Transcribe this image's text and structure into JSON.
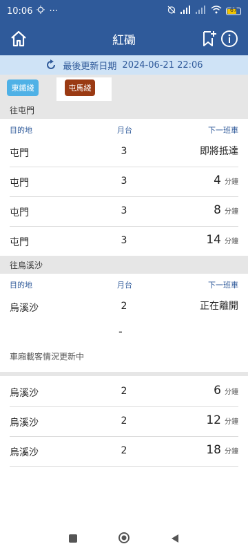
{
  "status": {
    "time": "10:06",
    "dots": "···",
    "battery": "67"
  },
  "app": {
    "title": "紅磡"
  },
  "update": {
    "label": "最後更新日期",
    "datetime": "2024-06-21 22:06"
  },
  "tabs": [
    {
      "label": "東鐵綫",
      "color": "#4fb1e6"
    },
    {
      "label": "屯馬綫",
      "color": "#9a3a13"
    }
  ],
  "sections": [
    {
      "title": "往屯門",
      "headers": {
        "destination": "目的地",
        "platform": "月台",
        "next_train": "下一班車"
      },
      "rows": [
        {
          "destination": "屯門",
          "platform": "3",
          "next_text": "即將抵達"
        },
        {
          "destination": "屯門",
          "platform": "3",
          "next_num": "4",
          "unit": "分鐘"
        },
        {
          "destination": "屯門",
          "platform": "3",
          "next_num": "8",
          "unit": "分鐘"
        },
        {
          "destination": "屯門",
          "platform": "3",
          "next_num": "14",
          "unit": "分鐘"
        }
      ]
    },
    {
      "title": "往烏溪沙",
      "headers": {
        "destination": "目的地",
        "platform": "月台",
        "next_train": "下一班車"
      },
      "first_row": {
        "destination": "烏溪沙",
        "platform": "2",
        "next_text": "正在離開"
      },
      "dash": "-",
      "occupancy_text": "車廂載客情況更新中",
      "rows": [
        {
          "destination": "烏溪沙",
          "platform": "2",
          "next_num": "6",
          "unit": "分鐘"
        },
        {
          "destination": "烏溪沙",
          "platform": "2",
          "next_num": "12",
          "unit": "分鐘"
        },
        {
          "destination": "烏溪沙",
          "platform": "2",
          "next_num": "18",
          "unit": "分鐘"
        }
      ]
    }
  ]
}
